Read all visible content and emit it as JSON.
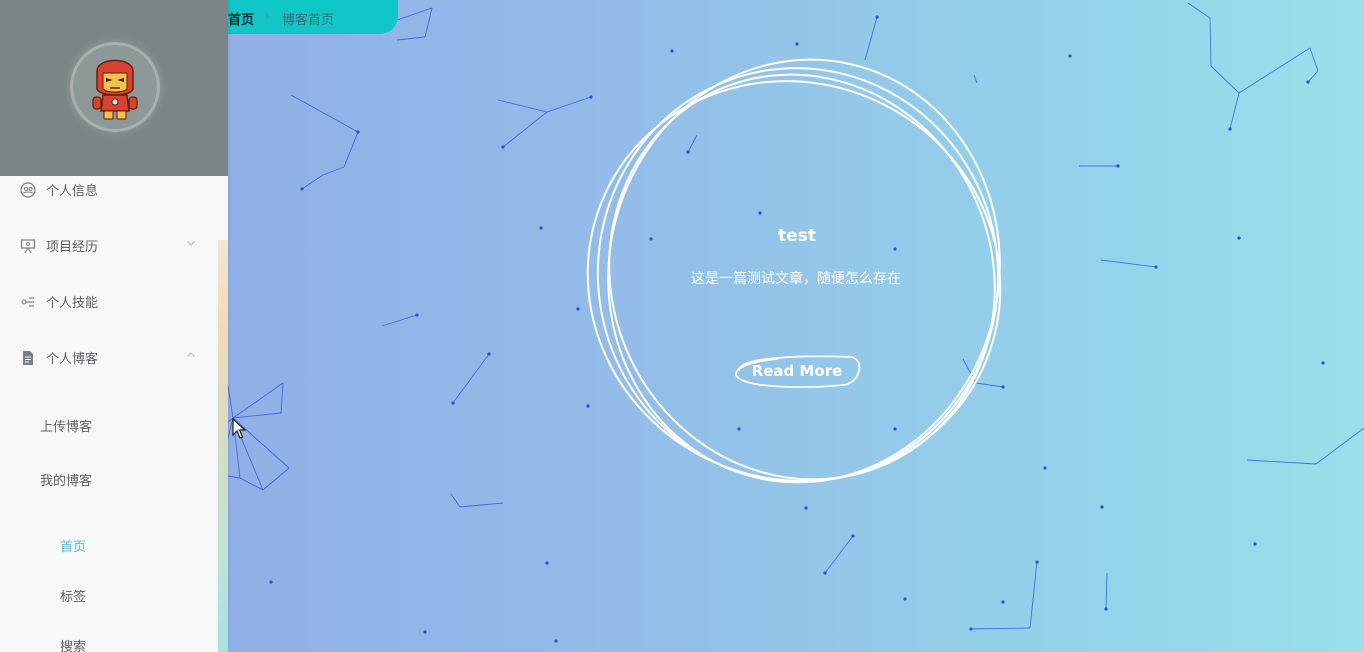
{
  "breadcrumb": {
    "home": "首页",
    "separator": "›",
    "current": "博客首页"
  },
  "sidebar": {
    "menu": [
      {
        "label": "个人信息",
        "icon": "user-circle-icon"
      },
      {
        "label": "项目经历",
        "icon": "presentation-icon",
        "expandable": true,
        "expanded": false
      },
      {
        "label": "个人技能",
        "icon": "skills-icon"
      },
      {
        "label": "个人博客",
        "icon": "document-icon",
        "expandable": true,
        "expanded": true
      }
    ],
    "blog_submenu": [
      {
        "label": "上传博客"
      },
      {
        "label": "我的博客"
      }
    ],
    "my_blog_submenu": [
      {
        "label": "首页",
        "active": true
      },
      {
        "label": "标签"
      },
      {
        "label": "搜索"
      }
    ]
  },
  "article": {
    "title": "test",
    "summary": "这是一篇测试文章，随便怎么存在",
    "button": "Read More"
  },
  "colors": {
    "accent": "#11c6c6",
    "active_link": "#5dbbd6",
    "particle": "#2b4fd8",
    "header_bg": "#7a8587"
  }
}
